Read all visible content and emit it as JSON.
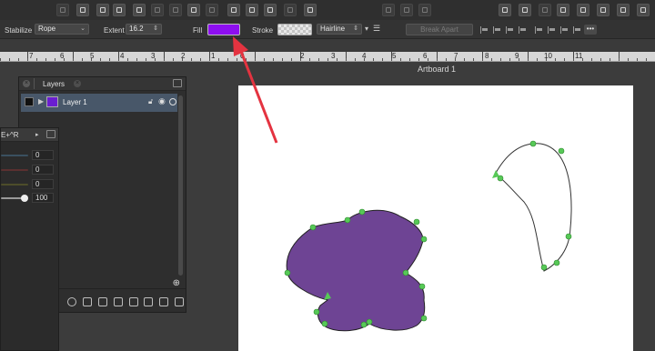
{
  "context_toolbar": {
    "stabilize_label": "Stabilize",
    "stabilize_value": "Rope",
    "extent_label": "Extent",
    "extent_value": "16.2",
    "fill_label": "Fill",
    "fill_color": "#8d0ef0",
    "stroke_label": "Stroke",
    "stroke_width_value": "Hairline",
    "break_apart_label": "Break Apart"
  },
  "ruler": {
    "ticks": [
      "7",
      "6",
      "5",
      "4",
      "3",
      "2",
      "1",
      "0",
      "1",
      "2",
      "3",
      "4",
      "5",
      "6",
      "7",
      "8",
      "9",
      "10",
      "11"
    ]
  },
  "artboard": {
    "title": "Artboard 1",
    "shape_fill_color": "#6e4494",
    "node_color": "#57c957"
  },
  "layers_panel": {
    "tab_label": "Layers",
    "layer_name": "Layer 1"
  },
  "color_panel": {
    "tab_label": "E+^R",
    "values": [
      "0",
      "0",
      "0",
      "100"
    ]
  },
  "annotation": {
    "arrow_color": "#e43340"
  }
}
